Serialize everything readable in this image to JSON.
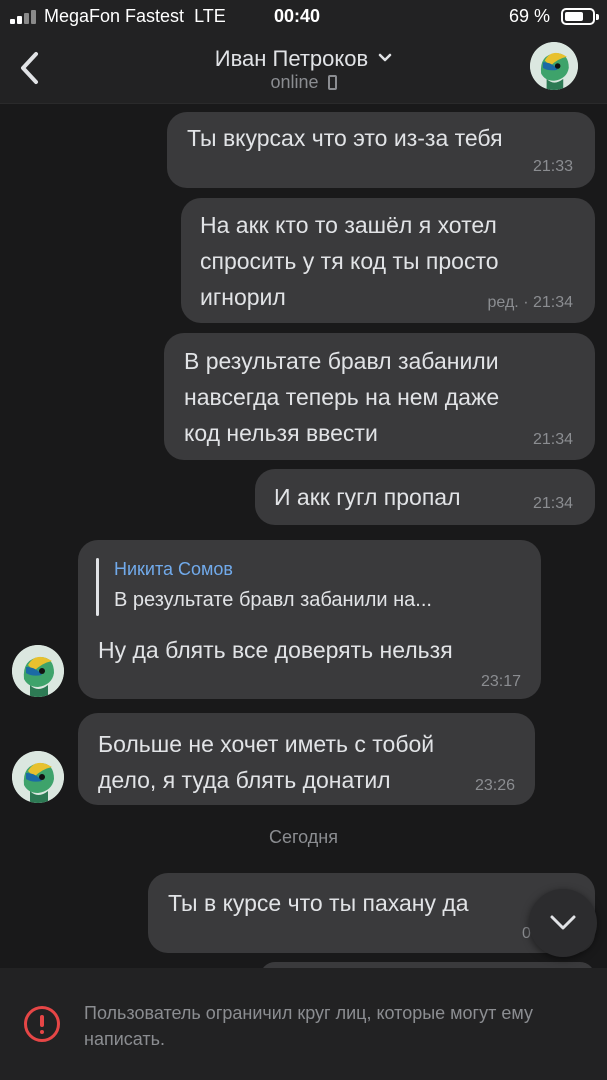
{
  "status_bar": {
    "carrier": "MegaFon Fastest",
    "network": "LTE",
    "time": "00:40",
    "battery": "69 %",
    "battery_level": 0.69
  },
  "header": {
    "name": "Иван Петроков",
    "status": "online"
  },
  "messages": [
    {
      "text": "Ты вкурсах что это из-за тебя",
      "time": "21:33"
    },
    {
      "text": "На акк кто то зашёл я хотел\nспросить у тя код ты просто\nигнорил",
      "time": "ред. · 21:34"
    },
    {
      "text": "В результате бравл забанили\nнавсегда теперь на нем даже\nкод нельзя ввести",
      "time": "21:34"
    },
    {
      "text": "И акк гугл пропал",
      "time": "21:34"
    },
    {
      "reply_name": "Никита Сомов",
      "reply_text": "В результате бравл забанили на...",
      "text": "Ну да блять все доверять нельзя",
      "time": "23:17"
    },
    {
      "text": "Больше не хочет иметь с тобой\nдело, я туда блять донатил",
      "time": "23:26"
    },
    {
      "text": "Ты в курсе что ты пахану да",
      "time": "0"
    }
  ],
  "day_separator": "Сегодня",
  "footer": {
    "text": "Пользователь ограничил круг лиц, которые могут ему написать."
  },
  "icons": {
    "back": "chevron-left-icon",
    "dropdown": "chevron-down-icon",
    "device": "phone-icon",
    "scroll": "chevron-down-icon",
    "warning": "exclamation-circle-icon"
  },
  "colors": {
    "background": "#19191a",
    "bar": "#222223",
    "bubble": "#3a3a3c",
    "reply_name": "#71aaeb",
    "warning": "#e64646"
  }
}
